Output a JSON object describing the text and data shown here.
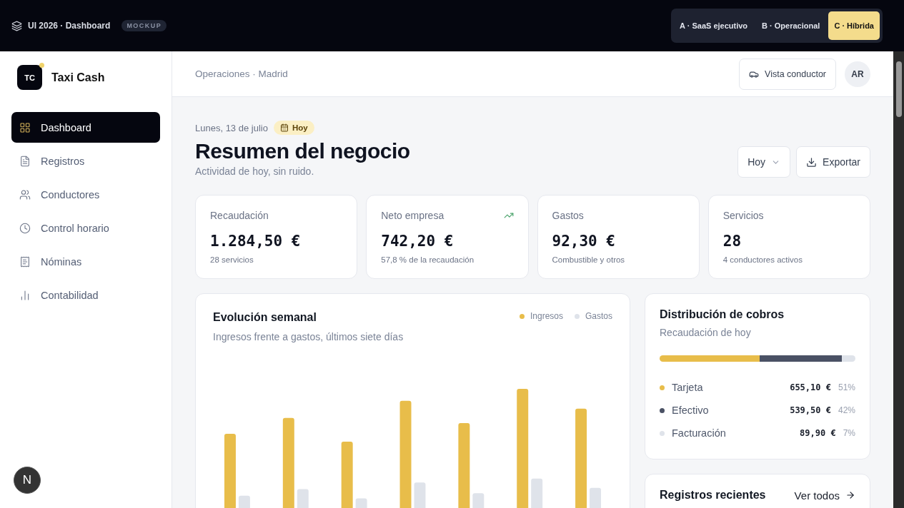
{
  "topbar": {
    "title": "UI 2026 · Dashboard",
    "badge": "MOCKUP",
    "variants": [
      {
        "label": "A · SaaS ejecutivo",
        "selected": false
      },
      {
        "label": "B · Operacional",
        "selected": false
      },
      {
        "label": "C · Híbrida",
        "selected": true
      }
    ]
  },
  "sidebar": {
    "logo": "TC",
    "brand": "Taxi Cash",
    "items": [
      {
        "label": "Dashboard",
        "selected": true
      },
      {
        "label": "Registros",
        "selected": false
      },
      {
        "label": "Conductores",
        "selected": false
      },
      {
        "label": "Control horario",
        "selected": false
      },
      {
        "label": "Nóminas",
        "selected": false
      },
      {
        "label": "Contabilidad",
        "selected": false
      }
    ],
    "dev_badge": "N"
  },
  "header": {
    "breadcrumb": "Operaciones · Madrid",
    "driver_view": "Vista conductor",
    "avatar": "AR"
  },
  "page": {
    "date": "Lunes, 13 de julio",
    "date_badge": "Hoy",
    "title": "Resumen del negocio",
    "subtitle": "Actividad de hoy, sin ruido.",
    "period": "Hoy",
    "export": "Exportar"
  },
  "kpis": [
    {
      "label": "Recaudación",
      "value": "1.284,50 €",
      "note": "28 servicios",
      "trend": false
    },
    {
      "label": "Neto empresa",
      "value": "742,20 €",
      "note": "57,8 % de la recaudación",
      "trend": true
    },
    {
      "label": "Gastos",
      "value": "92,30 €",
      "note": "Combustible y otros",
      "trend": false
    },
    {
      "label": "Servicios",
      "value": "28",
      "note": "4 conductores activos",
      "trend": false
    }
  ],
  "weekly": {
    "title": "Evolución semanal",
    "subtitle": "Ingresos frente a gastos, últimos siete días",
    "legend": [
      {
        "label": "Ingresos",
        "color": "#e8bd4a"
      },
      {
        "label": "Gastos",
        "color": "#dfe3ea"
      }
    ]
  },
  "distribution": {
    "title": "Distribución de cobros",
    "subtitle": "Recaudación de hoy",
    "items": [
      {
        "label": "Tarjeta",
        "amount": "655,10 €",
        "share": "51%",
        "color": "#e8bd4a"
      },
      {
        "label": "Efectivo",
        "amount": "539,50 €",
        "share": "42%",
        "color": "#4a5164"
      },
      {
        "label": "Facturación",
        "amount": "89,90 €",
        "share": "7%",
        "color": "#dfe3ea"
      }
    ]
  },
  "recent": {
    "title": "Registros recientes",
    "link": "Ver todos"
  }
}
